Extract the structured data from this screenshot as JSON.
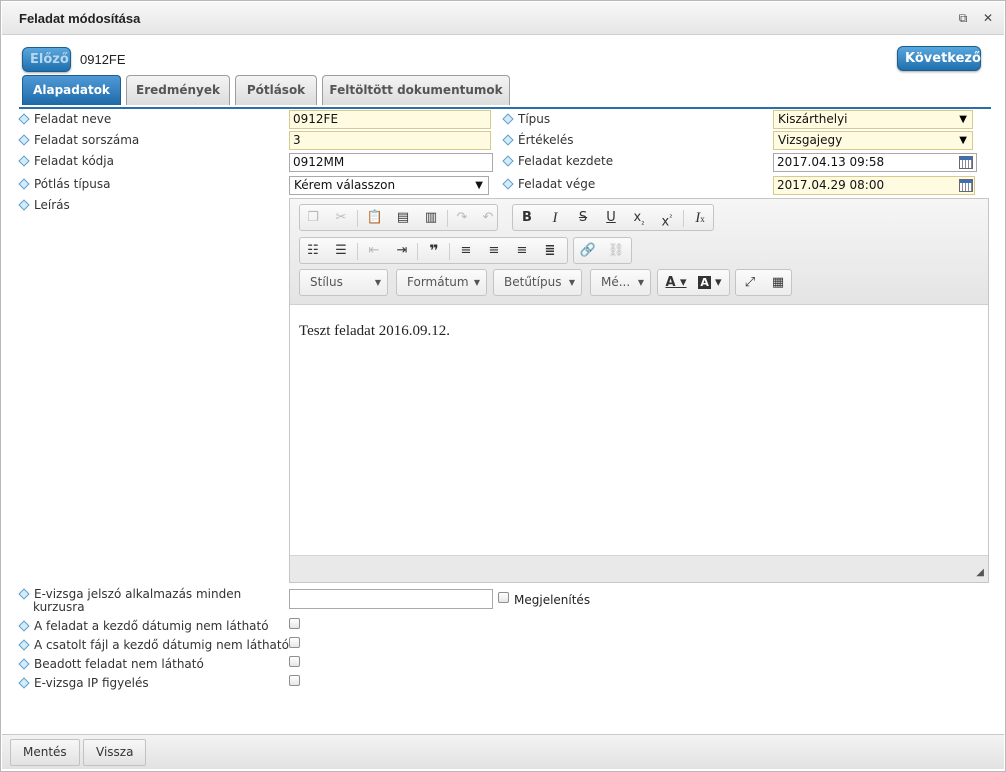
{
  "window": {
    "title": "Feladat módosítása",
    "popout_icon": "⧉",
    "close_icon": "✕"
  },
  "nav": {
    "prev_label": "Előző",
    "next_label": "Következő",
    "code": "0912FE"
  },
  "tabs": [
    {
      "label": "Alapadatok",
      "active": true
    },
    {
      "label": "Eredmények",
      "active": false
    },
    {
      "label": "Pótlások",
      "active": false
    },
    {
      "label": "Feltöltött dokumentumok",
      "active": false
    }
  ],
  "form": {
    "name_label": "Feladat neve",
    "name_value": "0912FE",
    "seq_label": "Feladat sorszáma",
    "seq_value": "3",
    "code_label": "Feladat kódja",
    "code_value": "0912MM",
    "makeup_label": "Pótlás típusa",
    "makeup_value": "Kérem válasszon",
    "desc_label": "Leírás",
    "type_label": "Típus",
    "type_value": "Kiszárthelyi",
    "eval_label": "Értékelés",
    "eval_value": "Vizsgajegy",
    "start_label": "Feladat kezdete",
    "start_value": "2017.04.13 09:58",
    "end_label": "Feladat vége",
    "end_value": "2017.04.29 08:00"
  },
  "editor": {
    "style_combo": "Stílus",
    "format_combo": "Formátum",
    "font_combo": "Betűtípus",
    "size_combo": "Mé...",
    "content": "Teszt feladat 2016.09.12."
  },
  "extra": {
    "evizsga_label_line1": "E-vizsga jelszó alkalmazás minden",
    "evizsga_label_line2": "kurzusra",
    "show_label": "Megjelenítés",
    "hide_until_start_label": "A feladat a kezdő dátumig nem látható",
    "attach_hidden_label": "A csatolt fájl a kezdő dátumig nem látható",
    "submitted_hidden_label": "Beadott feladat nem látható",
    "ip_watch_label": "E-vizsga IP figyelés"
  },
  "footer": {
    "save_label": "Mentés",
    "back_label": "Vissza"
  }
}
